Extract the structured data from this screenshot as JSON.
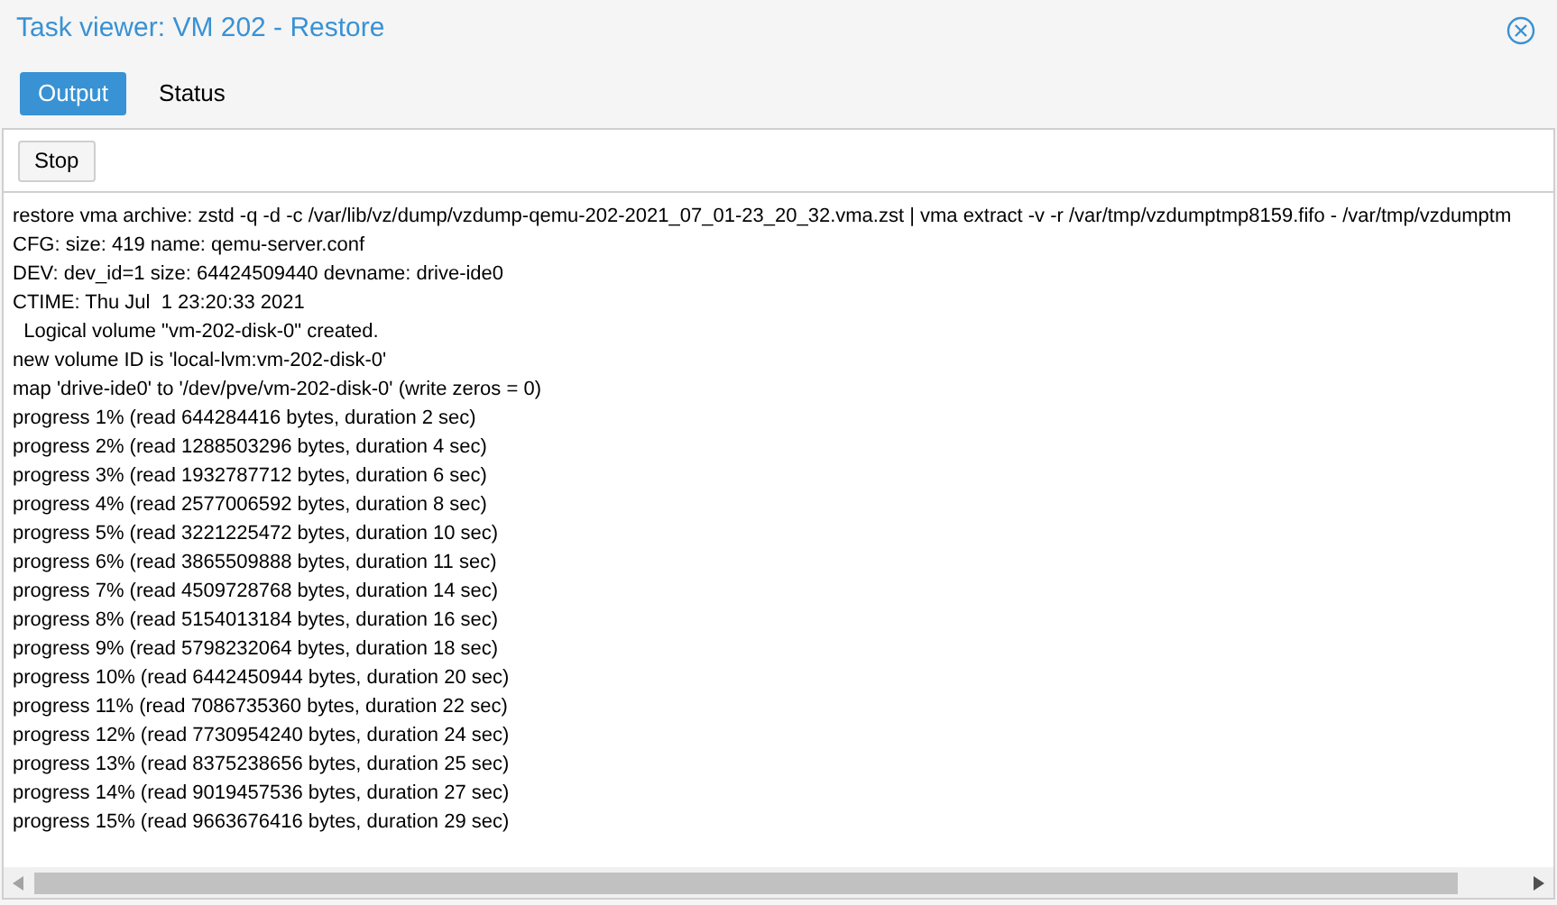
{
  "window": {
    "title": "Task viewer: VM 202 - Restore"
  },
  "tabs": [
    {
      "label": "Output",
      "selected": true
    },
    {
      "label": "Status",
      "selected": false
    }
  ],
  "toolbar": {
    "buttons": [
      "Stop"
    ]
  },
  "log": {
    "lines": [
      "restore vma archive: zstd -q -d -c /var/lib/vz/dump/vzdump-qemu-202-2021_07_01-23_20_32.vma.zst | vma extract -v -r /var/tmp/vzdumptmp8159.fifo - /var/tmp/vzdumptm",
      "CFG: size: 419 name: qemu-server.conf",
      "DEV: dev_id=1 size: 64424509440 devname: drive-ide0",
      "CTIME: Thu Jul  1 23:20:33 2021",
      "  Logical volume \"vm-202-disk-0\" created.",
      "new volume ID is 'local-lvm:vm-202-disk-0'",
      "map 'drive-ide0' to '/dev/pve/vm-202-disk-0' (write zeros = 0)",
      "progress 1% (read 644284416 bytes, duration 2 sec)",
      "progress 2% (read 1288503296 bytes, duration 4 sec)",
      "progress 3% (read 1932787712 bytes, duration 6 sec)",
      "progress 4% (read 2577006592 bytes, duration 8 sec)",
      "progress 5% (read 3221225472 bytes, duration 10 sec)",
      "progress 6% (read 3865509888 bytes, duration 11 sec)",
      "progress 7% (read 4509728768 bytes, duration 14 sec)",
      "progress 8% (read 5154013184 bytes, duration 16 sec)",
      "progress 9% (read 5798232064 bytes, duration 18 sec)",
      "progress 10% (read 6442450944 bytes, duration 20 sec)",
      "progress 11% (read 7086735360 bytes, duration 22 sec)",
      "progress 12% (read 7730954240 bytes, duration 24 sec)",
      "progress 13% (read 8375238656 bytes, duration 25 sec)",
      "progress 14% (read 9019457536 bytes, duration 27 sec)",
      "progress 15% (read 9663676416 bytes, duration 29 sec)"
    ]
  }
}
